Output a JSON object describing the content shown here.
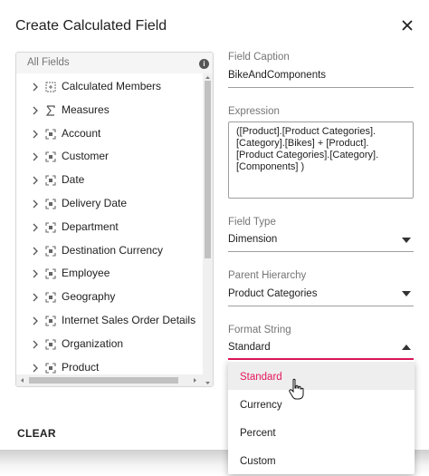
{
  "dialog": {
    "title": "Create Calculated Field",
    "close_icon": "close-icon"
  },
  "tree": {
    "header": "All Fields",
    "info_icon": "info-icon",
    "items": [
      {
        "label": "Calculated Members",
        "icon": "calculated-members-icon"
      },
      {
        "label": "Measures",
        "icon": "sigma-icon"
      },
      {
        "label": "Account",
        "icon": "dimension-icon"
      },
      {
        "label": "Customer",
        "icon": "dimension-icon"
      },
      {
        "label": "Date",
        "icon": "dimension-icon"
      },
      {
        "label": "Delivery Date",
        "icon": "dimension-icon"
      },
      {
        "label": "Department",
        "icon": "dimension-icon"
      },
      {
        "label": "Destination Currency",
        "icon": "dimension-icon"
      },
      {
        "label": "Employee",
        "icon": "dimension-icon"
      },
      {
        "label": "Geography",
        "icon": "dimension-icon"
      },
      {
        "label": "Internet Sales Order Details",
        "icon": "dimension-icon"
      },
      {
        "label": "Organization",
        "icon": "dimension-icon"
      },
      {
        "label": "Product",
        "icon": "dimension-icon"
      }
    ]
  },
  "field_caption": {
    "label": "Field Caption",
    "value": "BikeAndComponents"
  },
  "expression": {
    "label": "Expression",
    "value": "([Product].[Product Categories].[Category].[Bikes] + [Product].[Product Categories].[Category].[Components] )"
  },
  "field_type": {
    "label": "Field Type",
    "value": "Dimension"
  },
  "parent_hierarchy": {
    "label": "Parent Hierarchy",
    "value": "Product Categories"
  },
  "format_string": {
    "label": "Format String",
    "value": "Standard",
    "options": [
      "Standard",
      "Currency",
      "Percent",
      "Custom"
    ],
    "selected_index": 0
  },
  "footer": {
    "clear_label": "CLEAR"
  },
  "colors": {
    "accent": "#e3165b",
    "text": "#212121",
    "muted": "#757575",
    "border": "#9e9e9e"
  }
}
